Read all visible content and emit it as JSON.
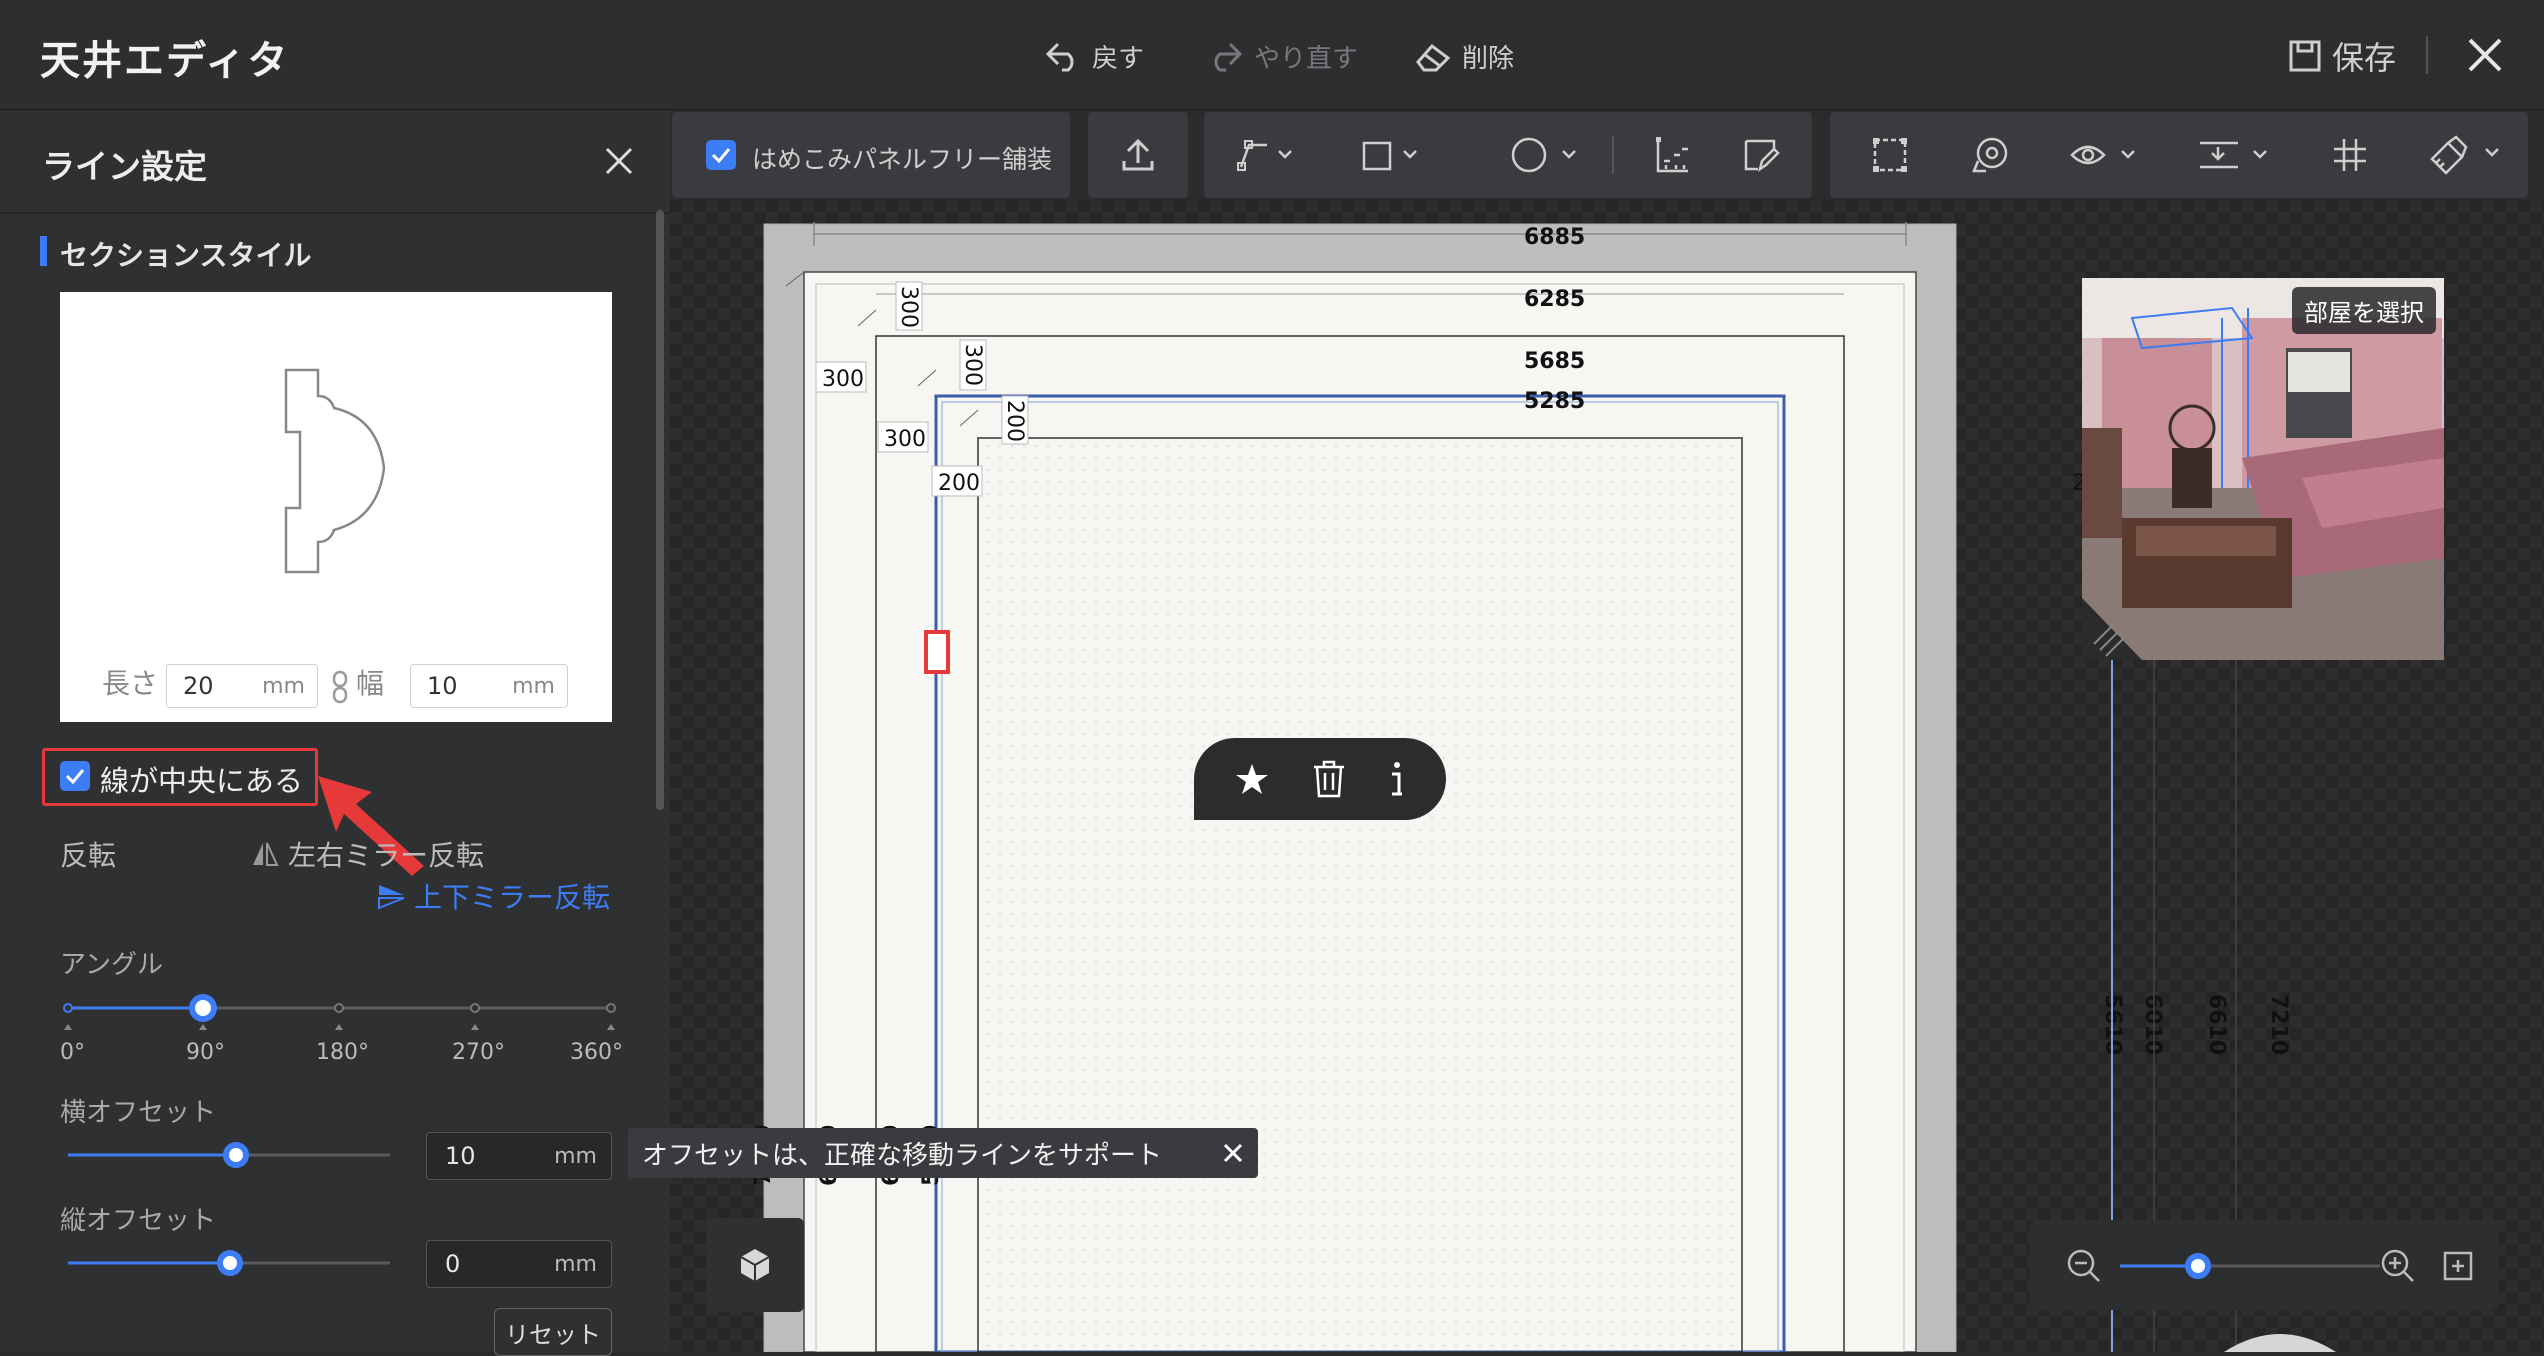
{
  "app": {
    "title": "天井エディタ"
  },
  "toolbar": {
    "undo_label": "戻す",
    "redo_label": "やり直す",
    "delete_label": "削除",
    "save_label": "保存",
    "panel_free_checkbox": "はめこみパネルフリー舗装"
  },
  "panel": {
    "title": "ライン設定",
    "section_title": "セクションスタイル",
    "length_label": "長さ",
    "length_value": "20",
    "width_label": "幅",
    "width_value": "10",
    "unit": "mm",
    "center_line_label": "線が中央にある",
    "flip_label": "反転",
    "flip_lr_label": "左右ミラー反転",
    "flip_ud_label": "上下ミラー反転",
    "angle_label": "アングル",
    "angle_value": 90,
    "angle_ticks": [
      "0°",
      "90°",
      "180°",
      "270°",
      "360°"
    ],
    "h_offset_label": "横オフセット",
    "h_offset_value": "10",
    "v_offset_label": "縦オフセット",
    "v_offset_value": "0",
    "reset_label": "リセット"
  },
  "canvas": {
    "dims_top": [
      "6885",
      "6285",
      "5685",
      "5285"
    ],
    "dims_small": [
      "300",
      "300",
      "300",
      "300",
      "200",
      "200",
      "2"
    ],
    "dims_left": [
      "7210",
      "6610",
      "6010",
      "5610"
    ],
    "dims_right": [
      "5610",
      "6010",
      "6610",
      "7210"
    ],
    "room_select_label": "部屋を選択",
    "tooltip_text": "オフセットは、正確な移動ラインをサポート"
  },
  "colors": {
    "accent": "#3c7cf5",
    "highlight": "#e5393a"
  }
}
